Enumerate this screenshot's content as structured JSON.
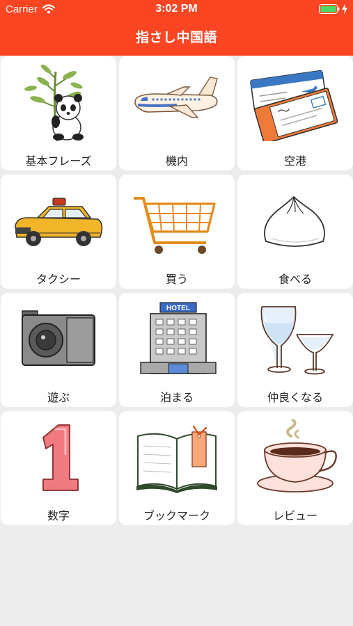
{
  "status_bar": {
    "carrier": "Carrier",
    "time": "3:02 PM"
  },
  "nav": {
    "title": "指さし中国語"
  },
  "colors": {
    "accent": "#fb4523",
    "background": "#ececec",
    "tile": "#ffffff"
  },
  "menu": {
    "items": [
      {
        "label": "基本フレーズ",
        "icon": "panda-bamboo-icon"
      },
      {
        "label": "機内",
        "icon": "airplane-icon"
      },
      {
        "label": "空港",
        "icon": "ticket-icon"
      },
      {
        "label": "タクシー",
        "icon": "taxi-icon"
      },
      {
        "label": "買う",
        "icon": "shopping-cart-icon"
      },
      {
        "label": "食べる",
        "icon": "bun-icon"
      },
      {
        "label": "遊ぶ",
        "icon": "camera-icon"
      },
      {
        "label": "泊まる",
        "icon": "hotel-icon"
      },
      {
        "label": "仲良くなる",
        "icon": "wine-glasses-icon"
      },
      {
        "label": "数字",
        "icon": "number-one-icon"
      },
      {
        "label": "ブックマーク",
        "icon": "bookmark-book-icon"
      },
      {
        "label": "レビュー",
        "icon": "coffee-cup-icon"
      }
    ]
  }
}
